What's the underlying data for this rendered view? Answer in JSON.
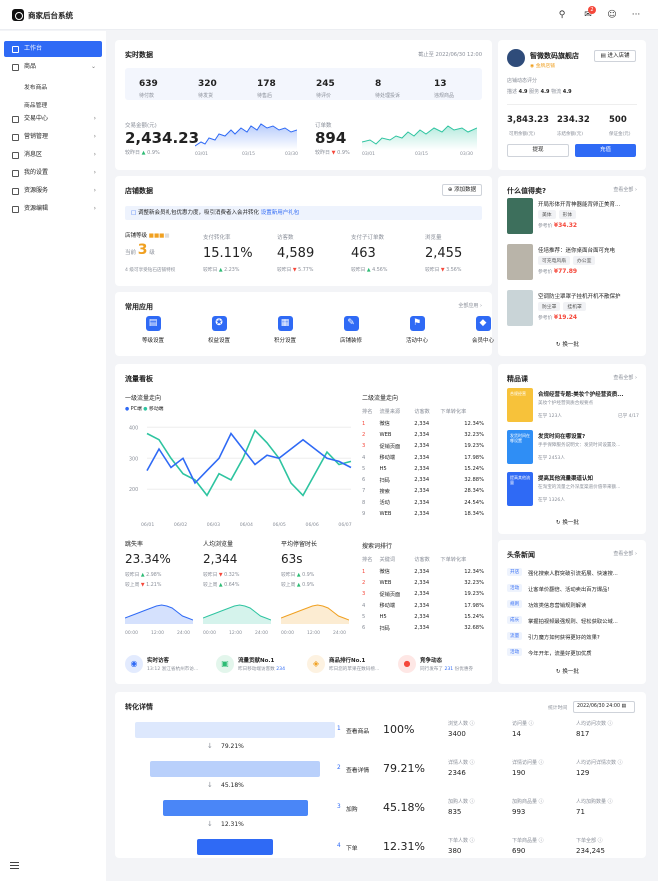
{
  "header": {
    "brand": "商家后台系统",
    "badge": "2"
  },
  "sidebar": {
    "items": [
      {
        "label": "工作台",
        "active": true
      },
      {
        "label": "商品"
      },
      {
        "label": "发布商品",
        "sub": true
      },
      {
        "label": "商品管理",
        "sub": true
      },
      {
        "label": "交易中心"
      },
      {
        "label": "营销管理"
      },
      {
        "label": "消息区"
      },
      {
        "label": "我的设置"
      },
      {
        "label": "资源服务"
      },
      {
        "label": "资源编辑"
      }
    ]
  },
  "realtime": {
    "title": "实时数据",
    "deadline": "截止至 2022/06/30 12:00",
    "stats": [
      {
        "value": "639",
        "label": "待付款"
      },
      {
        "value": "320",
        "label": "待发货"
      },
      {
        "value": "178",
        "label": "待售后"
      },
      {
        "value": "245",
        "label": "待评价"
      },
      {
        "value": "8",
        "label": "待处理投诉"
      },
      {
        "value": "13",
        "label": "违规商品"
      }
    ],
    "gmv": {
      "label": "交易金额(元)",
      "value": "2,434.23",
      "compare": "较昨日",
      "pct": "0.9%",
      "dates": [
        "03/01",
        "03/15",
        "03/30"
      ]
    },
    "orders": {
      "label": "订单数",
      "value": "894",
      "compare": "较昨日",
      "pct": "0.9%",
      "dates": [
        "03/01",
        "03/15",
        "03/30"
      ]
    }
  },
  "shop": {
    "name": "智微数码旗舰店",
    "badge": "金牌店铺",
    "enter": "进入店铺",
    "eval_title": "店铺动态评分",
    "ratings": [
      {
        "k": "描述",
        "v": "4.9"
      },
      {
        "k": "服务",
        "v": "4.9"
      },
      {
        "k": "物流",
        "v": "4.9"
      }
    ],
    "money": [
      {
        "value": "3,843.23",
        "label": "可用余额(元)"
      },
      {
        "value": "234.32",
        "label": "冻结余额(元)"
      },
      {
        "value": "500",
        "label": "保证金(元)"
      }
    ],
    "withdraw": "提现",
    "recharge": "充值"
  },
  "shopdata": {
    "title": "店铺数据",
    "add": "添加数据",
    "notice": "调整新会员礼包优惠力度，吸引消费者入会并转化",
    "notice_link": "设置新用户礼包",
    "level_label": "店铺等级",
    "level_prefix": "当前",
    "level": "3",
    "level_suffix": "级",
    "level_hint": "4 级可享受钻石店铺特权",
    "metrics": [
      {
        "label": "支付转化率",
        "value": "15.11%",
        "compare": "较昨日",
        "pct": "2.23%",
        "dir": "up"
      },
      {
        "label": "访客数",
        "value": "4,589",
        "compare": "较昨日",
        "pct": "5.77%",
        "dir": "dn"
      },
      {
        "label": "支付子订单数",
        "value": "463",
        "compare": "较昨日",
        "pct": "4.56%",
        "dir": "up"
      },
      {
        "label": "浏览量",
        "value": "2,455",
        "compare": "较昨日",
        "pct": "3.56%",
        "dir": "dn"
      }
    ]
  },
  "apps": {
    "title": "常用应用",
    "all": "全部应用",
    "items": [
      {
        "label": "等级设置",
        "icon": "bookmark-icon"
      },
      {
        "label": "权益设置",
        "icon": "badge-icon"
      },
      {
        "label": "积分设置",
        "icon": "points-icon"
      },
      {
        "label": "店铺装修",
        "icon": "paint-icon"
      },
      {
        "label": "活动中心",
        "icon": "flag-icon"
      },
      {
        "label": "会员中心",
        "icon": "diamond-icon"
      }
    ]
  },
  "traffic": {
    "title": "流量看板",
    "l1": "一级流量走向",
    "legend": [
      "PC端",
      "移动端"
    ],
    "colors": [
      "#2f6af5",
      "#2ec4a0"
    ],
    "l2": "二级流量走向",
    "l2cols": [
      "排名",
      "流量来源",
      "访客数",
      "下单转化率"
    ],
    "l2rows": [
      [
        "1",
        "微信",
        "2,334",
        "12.34%"
      ],
      [
        "2",
        "WEB",
        "2,334",
        "32.23%"
      ],
      [
        "3",
        "促销页面",
        "2,334",
        "19.23%"
      ],
      [
        "4",
        "移动端",
        "2,334",
        "17.98%"
      ],
      [
        "5",
        "H5",
        "2,334",
        "15.24%"
      ],
      [
        "6",
        "扫码",
        "2,334",
        "32.88%"
      ],
      [
        "7",
        "搜索",
        "2,334",
        "28.34%"
      ],
      [
        "8",
        "活动",
        "2,334",
        "24.54%"
      ],
      [
        "9",
        "WEB",
        "2,334",
        "18.34%"
      ]
    ],
    "small": [
      {
        "label": "跳失率",
        "value": "23.34%",
        "a": "较昨日",
        "ap": "2.98%",
        "ad": "up",
        "b": "较上周",
        "bp": "1.21%",
        "bd": "dn"
      },
      {
        "label": "人均浏览量",
        "value": "2,344",
        "a": "较昨日",
        "ap": "0.32%",
        "ad": "dn",
        "b": "较上周",
        "bp": "0.64%",
        "bd": "up"
      },
      {
        "label": "平均停留时长",
        "value": "63s",
        "a": "较昨日",
        "ap": "0.9%",
        "ad": "up",
        "b": "较上周",
        "bp": "0.9%",
        "bd": "up"
      }
    ],
    "times": [
      "00:00",
      "12:00",
      "24:00"
    ],
    "kw": "搜索词排行",
    "kwcols": [
      "排名",
      "关键词",
      "访客数",
      "下单转化率"
    ],
    "kwrows": [
      [
        "1",
        "微信",
        "2,334",
        "12.34%"
      ],
      [
        "2",
        "WEB",
        "2,334",
        "32.23%"
      ],
      [
        "3",
        "促销页面",
        "2,334",
        "19.23%"
      ],
      [
        "4",
        "移动端",
        "2,334",
        "17.98%"
      ],
      [
        "5",
        "H5",
        "2,334",
        "15.24%"
      ],
      [
        "6",
        "扫码",
        "2,334",
        "32.68%"
      ]
    ],
    "feed": [
      {
        "title": "实时访客",
        "desc": "13:12 浙江省杭州市访...",
        "color": "#2f6af5"
      },
      {
        "title": "流量贡献No.1",
        "desc": "昨日移动端访客数",
        "num": "234",
        "color": "#2dbb74"
      },
      {
        "title": "商品排行No.1",
        "desc": "昨日您的苹果在数码榜...",
        "color": "#f0a020"
      },
      {
        "title": "竞争动态",
        "desc": "同行发布了",
        "num": "231",
        "tail": "份优惠券",
        "color": "#f5483b"
      }
    ]
  },
  "worth": {
    "title": "什么值得卖?",
    "all": "查看全部",
    "items": [
      {
        "title": "开局形体开背神器能背卵正美育...",
        "tags": [
          "美体",
          "形体"
        ],
        "price_label": "参考价",
        "price": "¥34.32"
      },
      {
        "title": "佳培推荐：迷你桌面台面可充电",
        "tags": [
          "可充电风扇",
          "办公室"
        ],
        "price_label": "参考价",
        "price": "¥77.89"
      },
      {
        "title": "空调防尘罩罩子挂机开机不散保护",
        "tags": [
          "防尘罩",
          "挂机罩"
        ],
        "price_label": "参考价",
        "price": "¥19.24"
      }
    ],
    "refresh": "换一批"
  },
  "course": {
    "title": "精品课",
    "all": "查看全部",
    "items": [
      {
        "title": "合规经营专题:美妆个护经营资质...",
        "desc": "美妆个护经营资质合规要点",
        "study": "在学 123人",
        "extra": "已学 4/17",
        "thumb": "合规经营"
      },
      {
        "title": "发货时间在哪设置?",
        "desc": "手手保障服务说明文：发货时间设置及...",
        "study": "在学 2453人",
        "thumb": "发货时间在哪设置"
      },
      {
        "title": "提高其他流量渠道认知",
        "desc": "在淘宝的流量之外深度渠道价值带来额...",
        "study": "在学 1326人",
        "thumb": "提高其他流量"
      }
    ],
    "refresh": "换一批"
  },
  "news": {
    "title": "头条新闻",
    "all": "查看全部",
    "items": [
      {
        "tag": "开店",
        "text": "强化搜索人群突破引流拓展、快速搜..."
      },
      {
        "tag": "活动",
        "text": "让客单价翻倍、活动卖出百万爆品!"
      },
      {
        "tag": "规则",
        "text": "功效类信息营销规则解读"
      },
      {
        "tag": "成长",
        "text": "掌握拍视频最强规则、轻松获取公域..."
      },
      {
        "tag": "流量",
        "text": "引力魔方如何获得更好的效果?"
      },
      {
        "tag": "活动",
        "text": "今年开年，流量好更加优质"
      }
    ],
    "refresh": "换一批"
  },
  "funnel": {
    "title": "转化详情",
    "stat_label": "统计时间",
    "date": "2022/06/30 24:00",
    "steps": [
      {
        "n": "1",
        "name": "查看商品",
        "pct": "100%",
        "m": [
          [
            "浏览人数",
            "3400"
          ],
          [
            "访问量",
            "14"
          ],
          [
            "人均访问次数",
            "817"
          ]
        ]
      },
      {
        "n": "2",
        "name": "查看详情",
        "pct": "79.21%",
        "m": [
          [
            "详情人数",
            "2346"
          ],
          [
            "详情访问量",
            "190"
          ],
          [
            "人均访问详情次数",
            "129"
          ]
        ]
      },
      {
        "n": "3",
        "name": "加购",
        "pct": "45.18%",
        "m": [
          [
            "加购人数",
            "835"
          ],
          [
            "加购商品量",
            "993"
          ],
          [
            "人均加购数量",
            "71"
          ]
        ]
      },
      {
        "n": "4",
        "name": "下单",
        "pct": "12.31%",
        "m": [
          [
            "下单人数",
            "380"
          ],
          [
            "下单商品量",
            "690"
          ],
          [
            "下单全部",
            "234,245"
          ]
        ]
      }
    ],
    "rates": [
      "79.21%",
      "45.18%",
      "12.31%"
    ]
  }
}
